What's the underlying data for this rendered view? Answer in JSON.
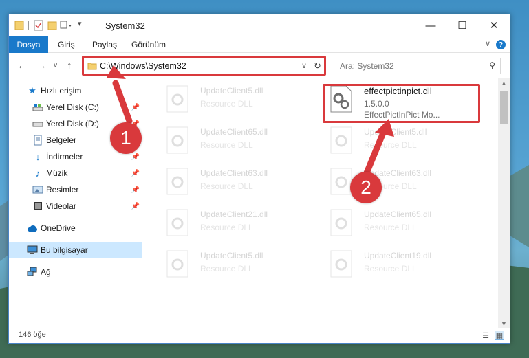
{
  "window": {
    "title": "System32"
  },
  "ribbon": {
    "tabs": [
      "Dosya",
      "Giriş",
      "Paylaş",
      "Görünüm"
    ]
  },
  "address": {
    "path": "C:\\Windows\\System32"
  },
  "search": {
    "placeholder": "Ara: System32"
  },
  "sidebar": {
    "items": [
      {
        "label": "Hızlı erişim",
        "icon": "star-icon",
        "pinned": false
      },
      {
        "label": "Yerel Disk (C:)",
        "icon": "drive-icon",
        "pinned": true
      },
      {
        "label": "Yerel Disk (D:)",
        "icon": "drive-icon",
        "pinned": true
      },
      {
        "label": "Belgeler",
        "icon": "document-icon",
        "pinned": true
      },
      {
        "label": "İndirmeler",
        "icon": "download-icon",
        "pinned": true
      },
      {
        "label": "Müzik",
        "icon": "music-icon",
        "pinned": true
      },
      {
        "label": "Resimler",
        "icon": "pictures-icon",
        "pinned": true
      },
      {
        "label": "Videolar",
        "icon": "video-icon",
        "pinned": true
      },
      {
        "label": "OneDrive",
        "icon": "cloud-icon",
        "pinned": false
      },
      {
        "label": "Bu bilgisayar",
        "icon": "computer-icon",
        "pinned": false,
        "selected": true
      },
      {
        "label": "Ağ",
        "icon": "network-icon",
        "pinned": false
      }
    ]
  },
  "files": {
    "left": [
      {
        "name": "UpdateClient5.dll",
        "type": "Resource DLL"
      },
      {
        "name": "UpdateClient65.dll",
        "type": "Resource DLL"
      },
      {
        "name": "UpdateClient63.dll",
        "type": "Resource DLL"
      },
      {
        "name": "UpdateClient21.dll",
        "type": "Resource DLL"
      },
      {
        "name": "UpdateClient5.dll",
        "type": "Resource DLL"
      }
    ],
    "selected": {
      "name": "effectpictinpict.dll",
      "version": "1.5.0.0",
      "description": "EffectPictInPict Mo..."
    },
    "right": [
      {
        "name": "UpdateClient5.dll",
        "type": "Resource DLL"
      },
      {
        "name": "UpdateClient63.dll",
        "type": "Resource DLL"
      },
      {
        "name": "UpdateClient65.dll",
        "type": "Resource DLL"
      },
      {
        "name": "UpdateClient19.dll",
        "type": "Resource DLL"
      }
    ]
  },
  "status": {
    "item_count": "146 öğe"
  },
  "annotations": {
    "step1": "1",
    "step2": "2",
    "color": "#d9393c"
  }
}
